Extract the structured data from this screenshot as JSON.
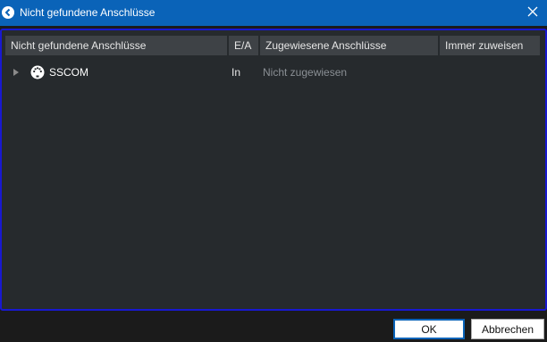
{
  "window": {
    "title": "Nicht gefundene Anschlüsse"
  },
  "table": {
    "columns": [
      "Nicht gefundene Anschlüsse",
      "E/A",
      "Zugewiesene Anschlüsse",
      "Immer zuweisen"
    ],
    "rows": [
      {
        "name": "SSCOM",
        "io": "In",
        "assigned": "Nicht zugewiesen",
        "icon": "midi-connector-icon"
      }
    ]
  },
  "buttons": {
    "ok": "OK",
    "cancel": "Abbrechen"
  },
  "colors": {
    "titlebar": "#0a63b8",
    "panel_border": "#1818d0",
    "panel_bg": "#262a2d",
    "header_bg": "#3e4246"
  }
}
